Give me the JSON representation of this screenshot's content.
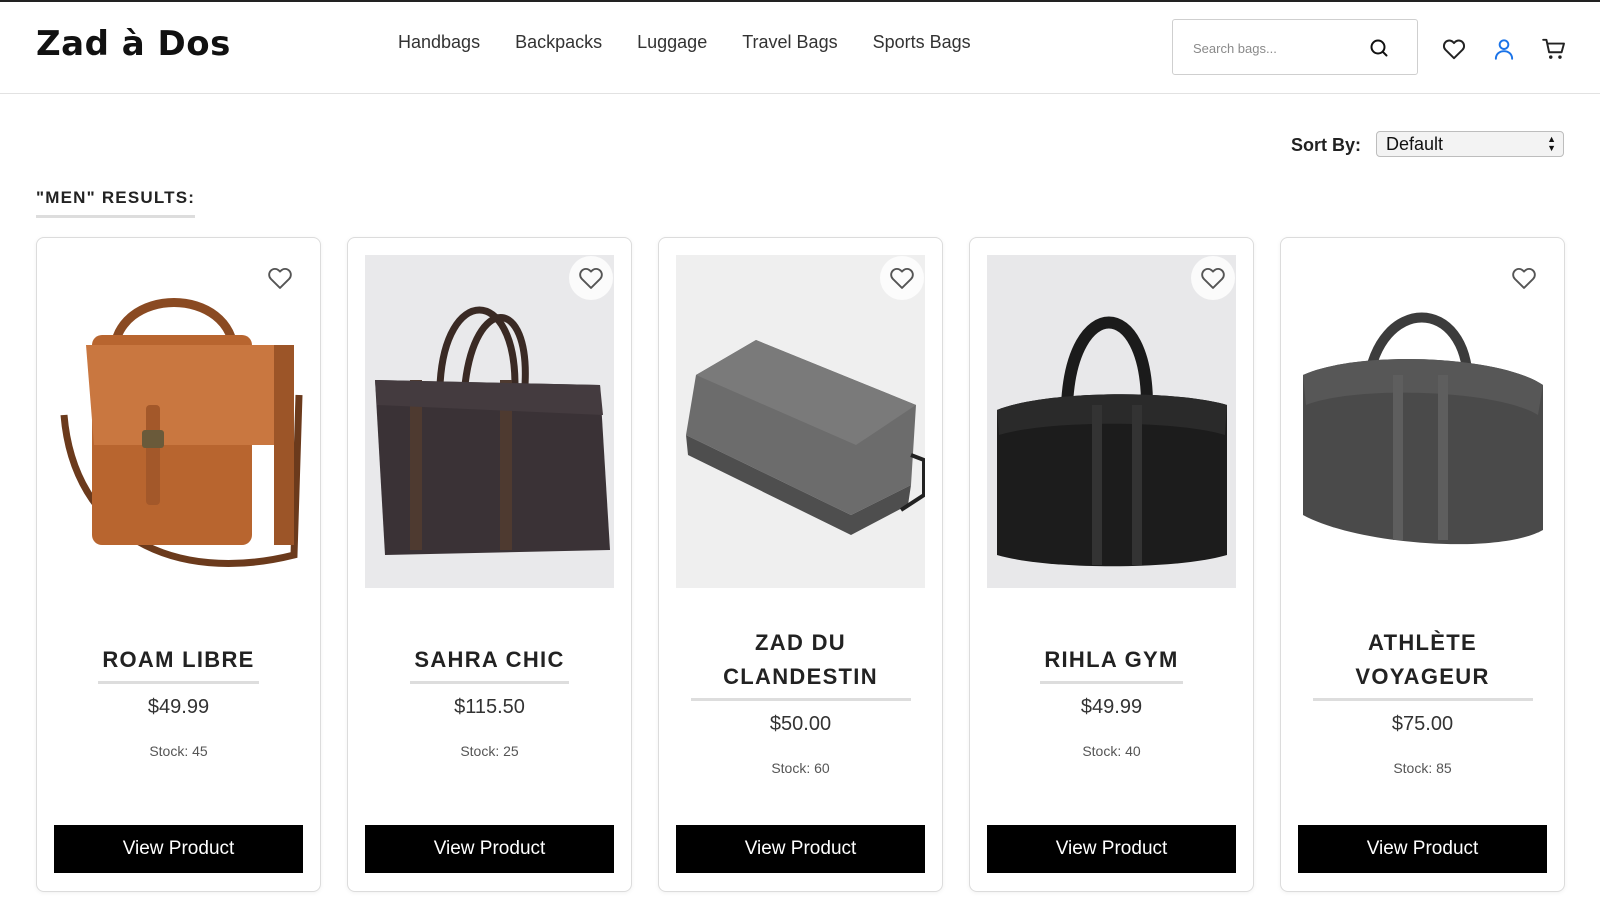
{
  "header": {
    "logo": "Zad à Dos",
    "nav": [
      "Handbags",
      "Backpacks",
      "Luggage",
      "Travel Bags",
      "Sports Bags"
    ],
    "search_placeholder": "Search bags...",
    "icons": [
      "heart-icon",
      "user-icon",
      "cart-icon"
    ]
  },
  "sort": {
    "label": "Sort By:",
    "selected": "Default"
  },
  "results_title": "\"MEN\" RESULTS:",
  "products": [
    {
      "name": "ROAM LIBRE",
      "price": "$49.99",
      "stock": "Stock: 45",
      "button": "View Product"
    },
    {
      "name": "SAHRA CHIC",
      "price": "$115.50",
      "stock": "Stock: 25",
      "button": "View Product"
    },
    {
      "name": "ZAD DU CLANDESTIN",
      "price": "$50.00",
      "stock": "Stock: 60",
      "button": "View Product"
    },
    {
      "name": "RIHLA GYM",
      "price": "$49.99",
      "stock": "Stock: 40",
      "button": "View Product"
    },
    {
      "name": "ATHLÈTE VOYAGEUR",
      "price": "$75.00",
      "stock": "Stock: 85",
      "button": "View Product"
    }
  ],
  "colors": {
    "accent": "#1a73e8",
    "button_bg": "#000000",
    "text": "#222222"
  }
}
